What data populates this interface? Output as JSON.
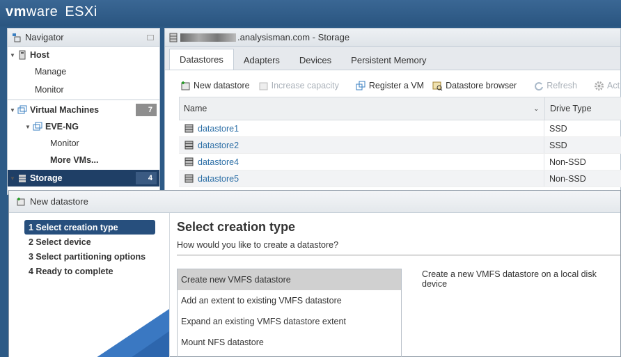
{
  "app": {
    "logo_vm": "vm",
    "logo_ware": "ware",
    "logo_product": "ESXi"
  },
  "navigator": {
    "title": "Navigator",
    "host": {
      "label": "Host",
      "children": [
        "Manage",
        "Monitor"
      ]
    },
    "vms": {
      "label": "Virtual Machines",
      "count": "7"
    },
    "eve": {
      "label": "EVE-NG",
      "children": [
        "Monitor",
        "More VMs..."
      ]
    },
    "storage": {
      "label": "Storage",
      "count": "4"
    }
  },
  "main": {
    "title": ".analysisman.com - Storage",
    "tabs": [
      "Datastores",
      "Adapters",
      "Devices",
      "Persistent Memory"
    ],
    "toolbar": {
      "new_datastore": "New datastore",
      "increase_capacity": "Increase capacity",
      "register_vm": "Register a VM",
      "datastore_browser": "Datastore browser",
      "refresh": "Refresh",
      "actions": "Act"
    },
    "grid": {
      "col_name": "Name",
      "col_drive": "Drive Type",
      "rows": [
        {
          "name": "datastore1",
          "drive": "SSD"
        },
        {
          "name": "datastore2",
          "drive": "SSD"
        },
        {
          "name": "datastore4",
          "drive": "Non-SSD"
        },
        {
          "name": "datastore5",
          "drive": "Non-SSD"
        }
      ]
    }
  },
  "modal": {
    "title": "New datastore",
    "steps": [
      "1 Select creation type",
      "2 Select device",
      "3 Select partitioning options",
      "4 Ready to complete"
    ],
    "heading": "Select creation type",
    "subheading": "How would you like to create a datastore?",
    "options": [
      "Create new VMFS datastore",
      "Add an extent to existing VMFS datastore",
      "Expand an existing VMFS datastore extent",
      "Mount NFS datastore"
    ],
    "description": "Create a new VMFS datastore on a local disk device"
  },
  "colors": {
    "brand": "#2d5a86",
    "selected": "#1f3f66",
    "link": "#2d6fa6"
  }
}
